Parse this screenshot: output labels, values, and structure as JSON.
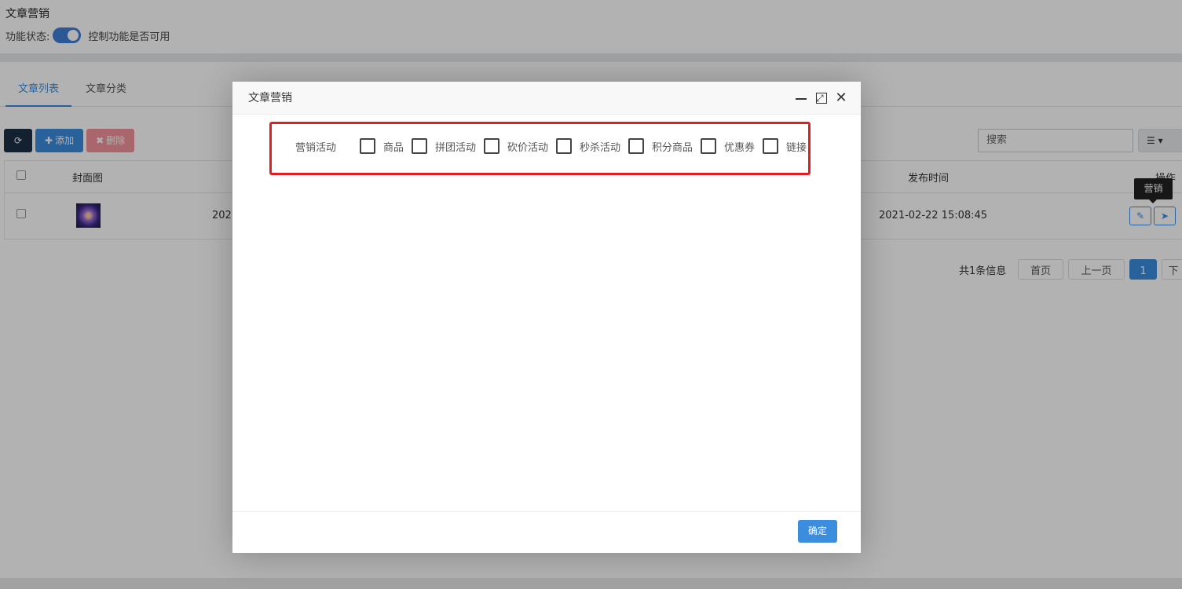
{
  "page": {
    "title": "文章营销",
    "status_label": "功能状态:",
    "status_desc": "控制功能是否可用"
  },
  "tabs": [
    {
      "label": "文章列表",
      "active": true
    },
    {
      "label": "文章分类",
      "active": false
    }
  ],
  "toolbar": {
    "add_label": "添加",
    "delete_label": "删除",
    "search_placeholder": "搜索"
  },
  "table": {
    "headers": {
      "cover": "封面图",
      "publish_time": "发布时间",
      "operation": "操作"
    },
    "rows": [
      {
        "date_partial": "2021",
        "publish_time": "2021-02-22 15:08:45"
      }
    ],
    "tooltip": "营销"
  },
  "pager": {
    "summary": "共1条信息",
    "first": "首页",
    "prev": "上一页",
    "current": "1",
    "next": "下"
  },
  "modal": {
    "title": "文章营销",
    "field_label": "营销活动",
    "options": [
      "商品",
      "拼团活动",
      "砍价活动",
      "秒杀活动",
      "积分商品",
      "优惠券",
      "链接"
    ],
    "confirm_label": "确定"
  },
  "colors": {
    "accent": "#3c8dde",
    "highlight": "#e02020"
  }
}
